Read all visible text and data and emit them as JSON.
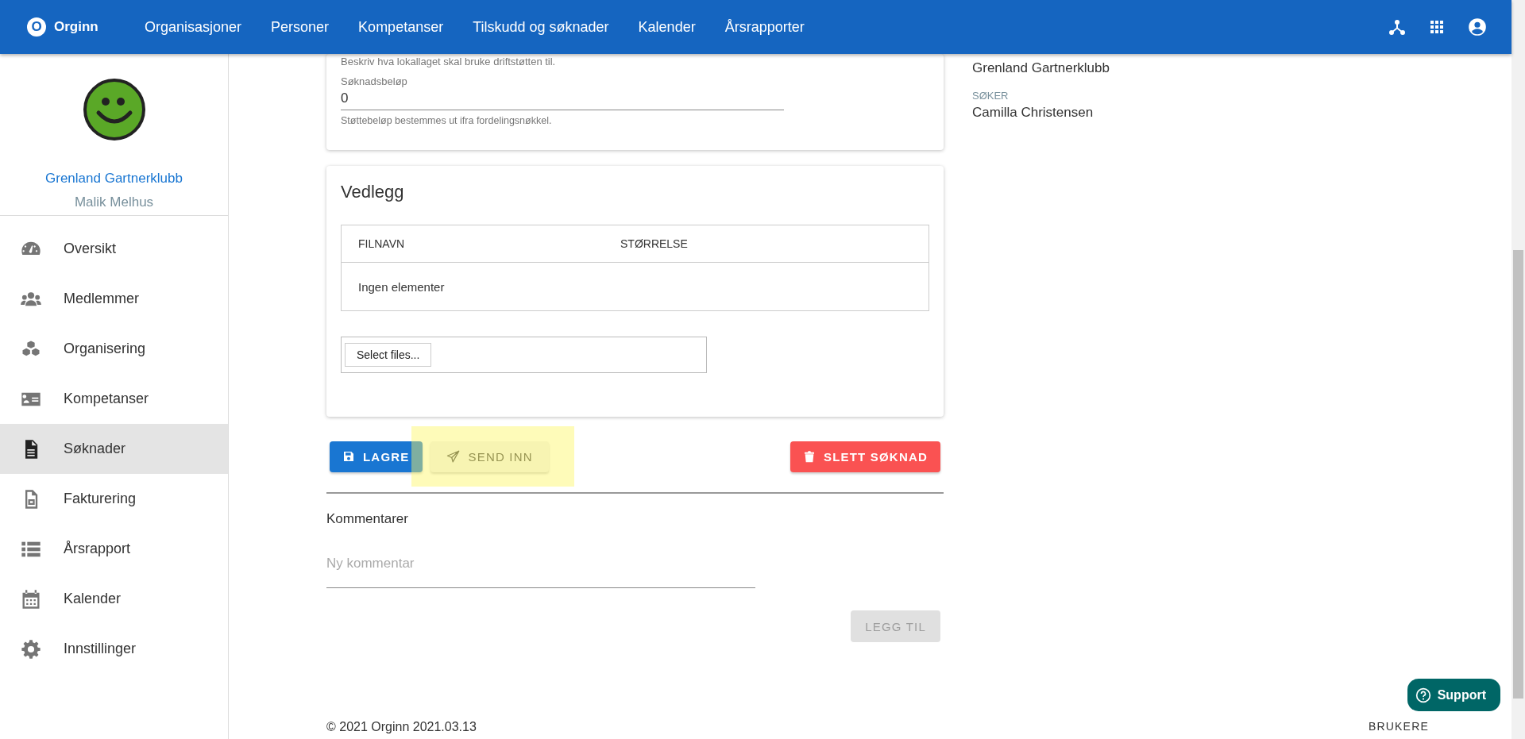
{
  "header": {
    "logo_letter": "O",
    "brand": "Orginn",
    "nav": [
      "Organisasjoner",
      "Personer",
      "Kompetanser",
      "Tilskudd og søknader",
      "Kalender",
      "Årsrapporter"
    ]
  },
  "sidebar": {
    "organization": "Grenland Gartnerklubb",
    "user": "Malik Melhus",
    "items": [
      {
        "label": "Oversikt",
        "selected": false
      },
      {
        "label": "Medlemmer",
        "selected": false
      },
      {
        "label": "Organisering",
        "selected": false
      },
      {
        "label": "Kompetanser",
        "selected": false
      },
      {
        "label": "Søknader",
        "selected": true
      },
      {
        "label": "Fakturering",
        "selected": false
      },
      {
        "label": "Årsrapport",
        "selected": false
      },
      {
        "label": "Kalender",
        "selected": false
      },
      {
        "label": "Innstillinger",
        "selected": false
      }
    ]
  },
  "form_card": {
    "hint": "Beskriv hva lokallaget skal bruke driftstøtten til.",
    "amount_field": {
      "label": "Søknadsbeløp",
      "value": "0",
      "helper": "Støttebeløp bestemmes ut ifra fordelingsnøkkel."
    }
  },
  "attachments": {
    "title": "Vedlegg",
    "columns": [
      "FILNAVN",
      "STØRRELSE"
    ],
    "empty_text": "Ingen elementer",
    "file_button": "Select files..."
  },
  "actions": [
    {
      "label": "LAGRE",
      "kind": "save",
      "highlighted": false
    },
    {
      "label": "SEND INN",
      "kind": "submit",
      "highlighted": true
    },
    {
      "label": "SLETT SØKNAD",
      "kind": "delete",
      "highlighted": false
    }
  ],
  "comments": {
    "title": "Kommentarer",
    "placeholder": "Ny kommentar",
    "add_button": {
      "label": "LEGG TIL",
      "disabled": true
    }
  },
  "footer": {
    "copyright": "© 2021 Orginn 2021.03.13",
    "link": "BRUKERE"
  },
  "info_panel": [
    {
      "value": "Grenland Gartnerklubb"
    },
    {
      "label": "SØKER",
      "value": "Camilla Christensen"
    }
  ],
  "support": {
    "label": "Support"
  }
}
